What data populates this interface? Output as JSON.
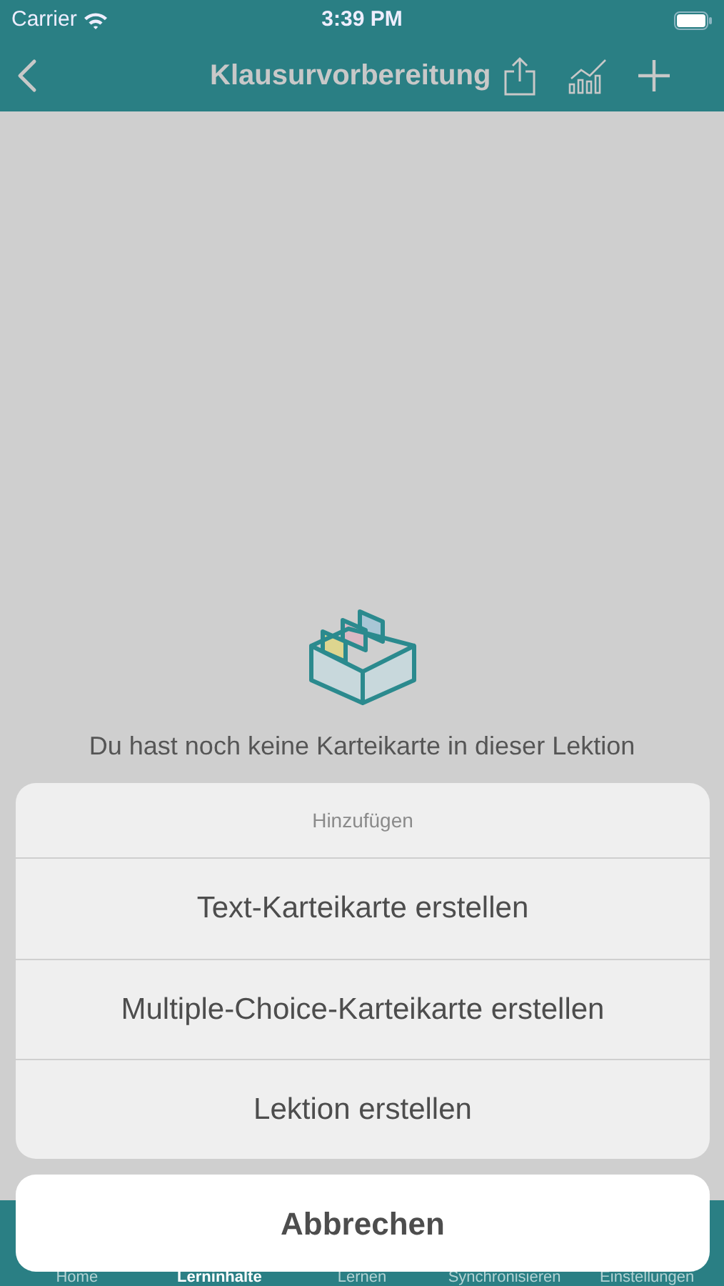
{
  "status_bar": {
    "carrier": "Carrier",
    "time": "3:39 PM"
  },
  "nav_bar": {
    "title": "Klausurvorbereitung"
  },
  "empty_state": {
    "message": "Du hast noch keine Karteikarte in dieser Lektion"
  },
  "tab_bar": [
    {
      "label": "Home",
      "selected": false
    },
    {
      "label": "Lerninhalte",
      "selected": true
    },
    {
      "label": "Lernen",
      "selected": false
    },
    {
      "label": "Synchronisieren",
      "selected": false
    },
    {
      "label": "Einstellungen",
      "selected": false
    }
  ],
  "action_sheet": {
    "title": "Hinzufügen",
    "actions": [
      "Text-Karteikarte erstellen",
      "Multiple-Choice-Karteikarte erstellen",
      "Lektion erstellen"
    ],
    "cancel": "Abbrechen"
  }
}
